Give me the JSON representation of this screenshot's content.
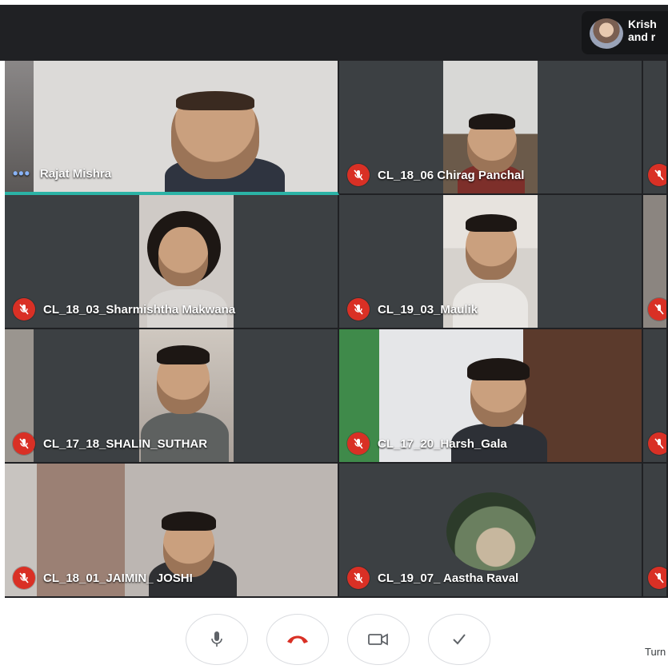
{
  "presenter": {
    "text_line1": "Krish",
    "text_line2": "and r"
  },
  "participants": [
    {
      "name": "Rajat Mishra",
      "muted": false,
      "speaking": true
    },
    {
      "name": "CL_18_06 Chirag Panchal",
      "muted": true
    },
    {
      "name": "CL_18_03_Sharmishtha Makwana",
      "muted": true
    },
    {
      "name": "CL_19_03_Maulik",
      "muted": true
    },
    {
      "name": "CL_17_18_SHALIN_SUTHAR",
      "muted": true
    },
    {
      "name": "CL_17_20_Harsh_Gala",
      "muted": true
    },
    {
      "name": "CL_18_01_JAIMIN_ JOSHI",
      "muted": true
    },
    {
      "name": "CL_19_07_ Aastha Raval",
      "muted": true
    }
  ],
  "controls": {
    "bottom_right_text": "Turn"
  },
  "colors": {
    "mute_red": "#d93025",
    "speaking_teal": "#2bb3a6",
    "tile_bg": "#3c4043"
  }
}
